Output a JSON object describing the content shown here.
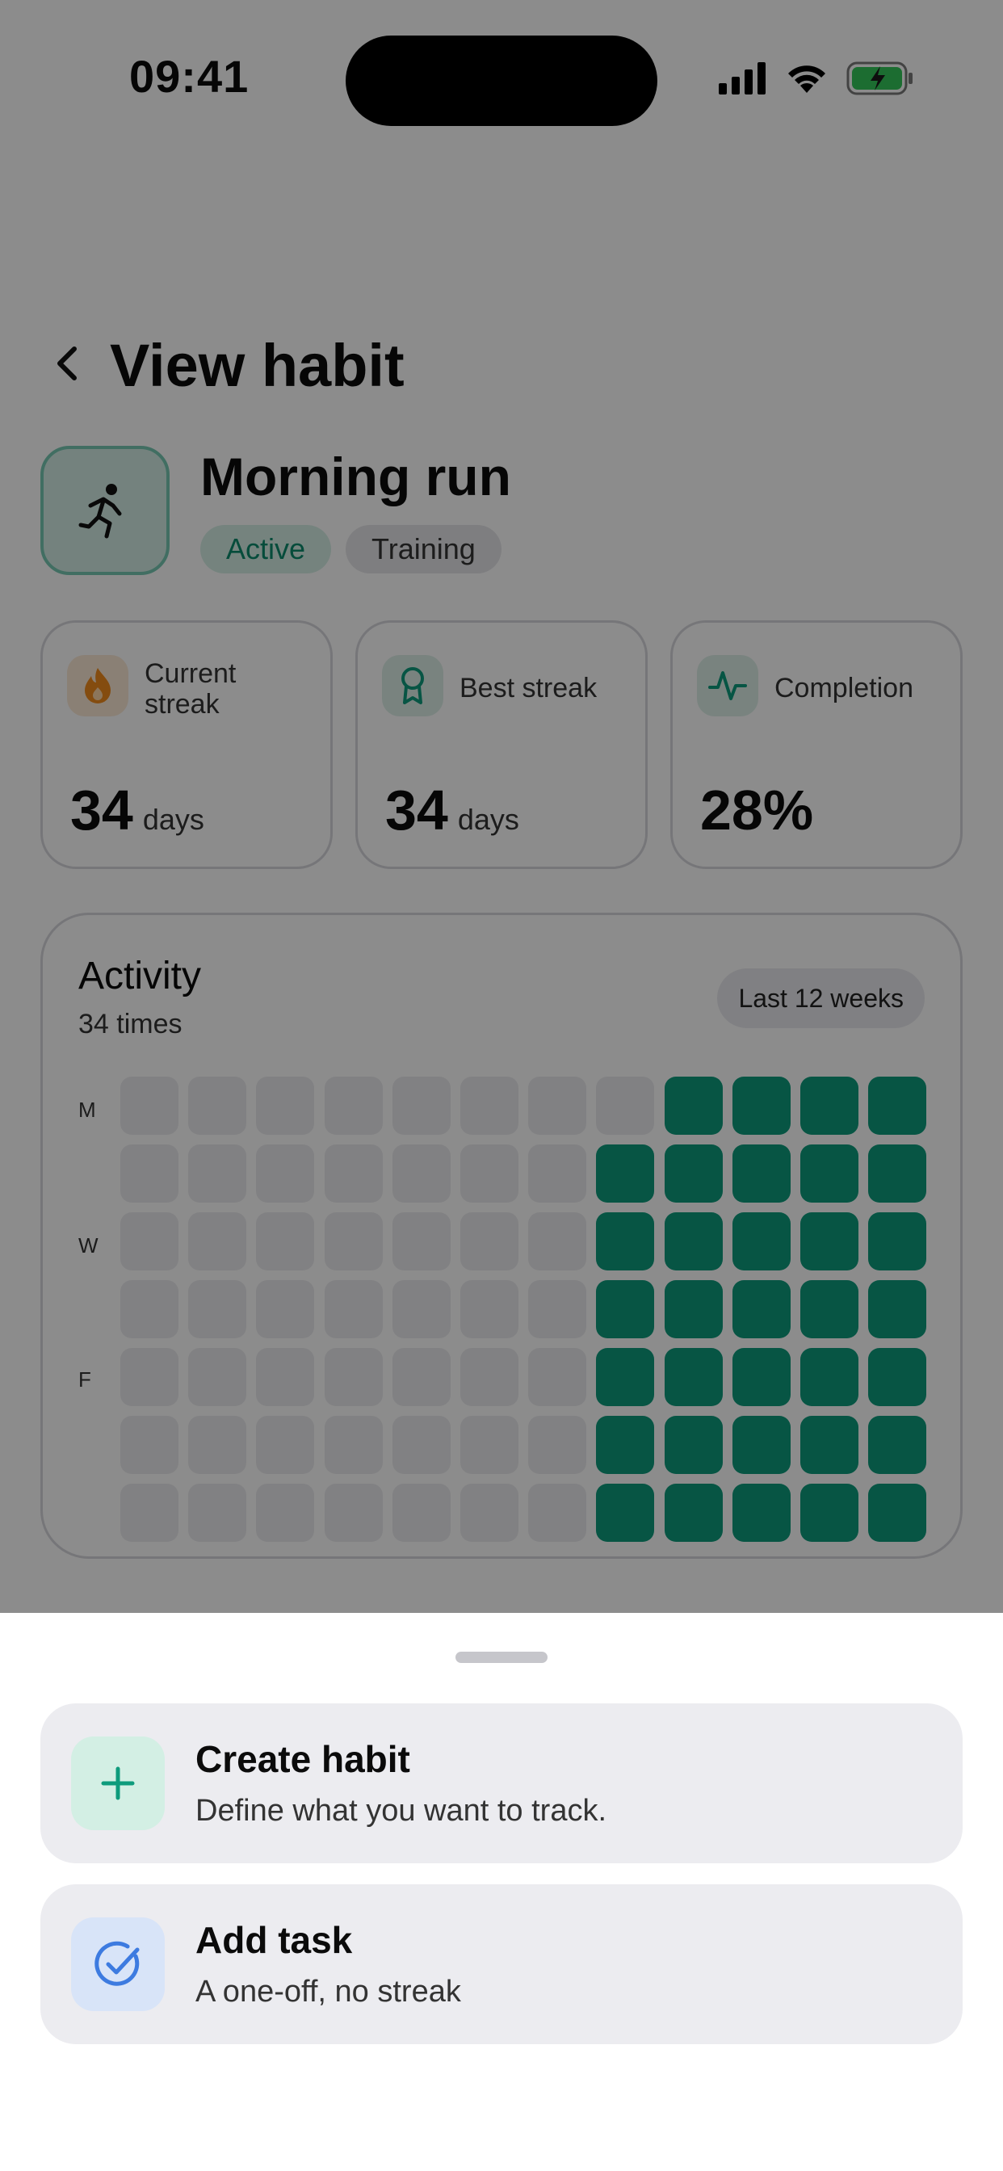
{
  "status_bar": {
    "time": "09:41"
  },
  "header": {
    "title": "View habit"
  },
  "habit": {
    "name": "Morning run",
    "tags": [
      "Active",
      "Training"
    ],
    "icon": "running-person-icon"
  },
  "stats": [
    {
      "label": "Current streak",
      "value": "34",
      "unit": "days",
      "icon": "flame-icon"
    },
    {
      "label": "Best streak",
      "value": "34",
      "unit": "days",
      "icon": "ribbon-award-icon"
    },
    {
      "label": "Completion",
      "value": "28%",
      "unit": "",
      "icon": "activity-pulse-icon"
    }
  ],
  "activity": {
    "title": "Activity",
    "count_text": "34 times",
    "range_label": "Last 12 weeks",
    "day_labels": [
      "M",
      "W",
      "F"
    ],
    "weeks": 12,
    "days": 7,
    "completed_from_week": {
      "M": 9,
      "default": 8
    }
  },
  "sheet": {
    "actions": [
      {
        "title": "Create habit",
        "description": "Define what you want to track.",
        "icon": "plus-icon"
      },
      {
        "title": "Add task",
        "description": "A one-off, no streak",
        "icon": "check-circle-icon"
      }
    ]
  },
  "colors": {
    "accent": "#0e9b7c",
    "accent_light": "#d6eee6",
    "blue_icon": "#3d7be0",
    "blue_icon_bg": "#d8e4f8",
    "flame": "#f08a1c"
  }
}
